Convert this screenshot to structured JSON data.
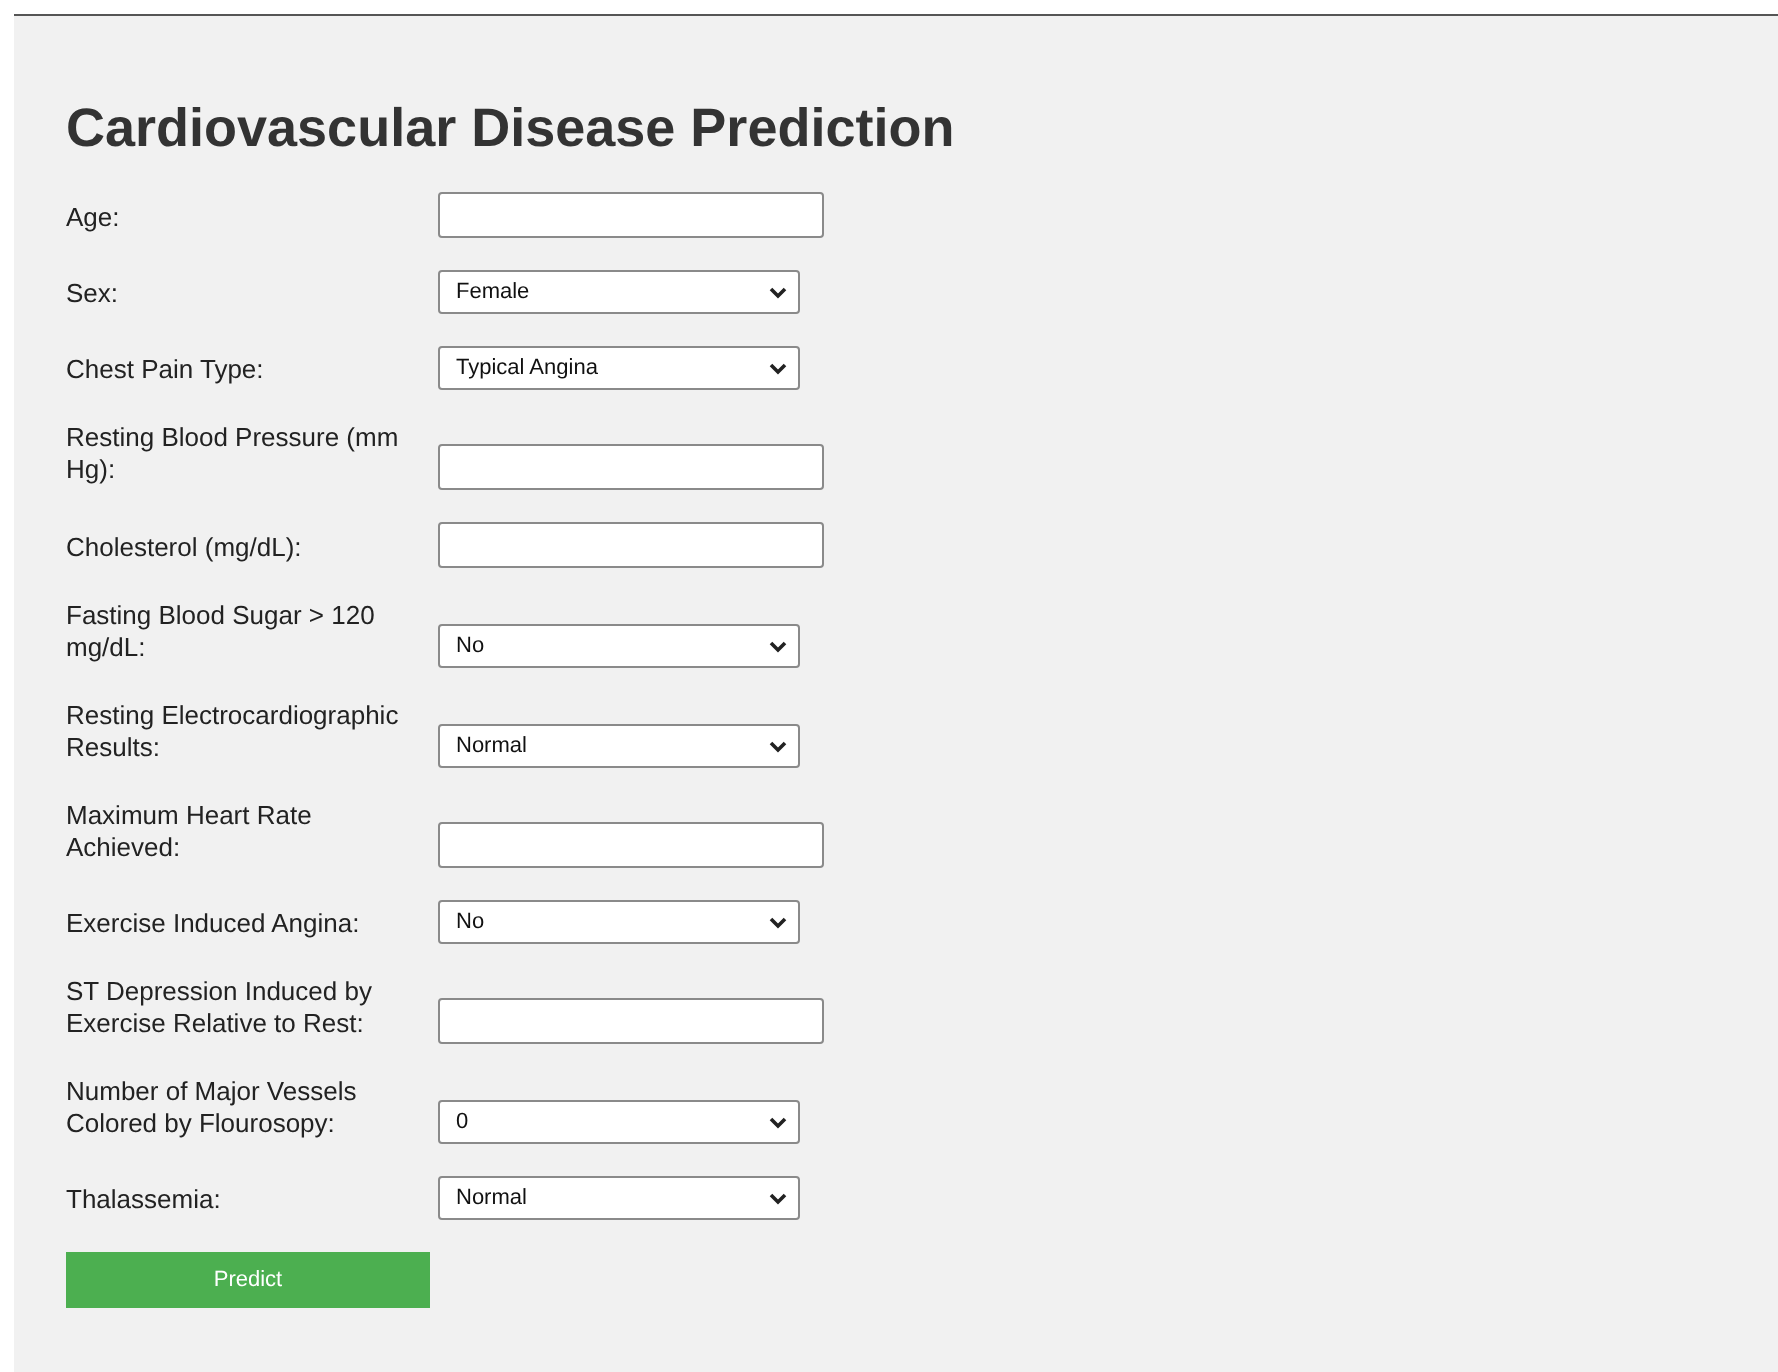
{
  "title": "Cardiovascular Disease Prediction",
  "fields": [
    {
      "label": "Age:",
      "kind": "text"
    },
    {
      "label": "Sex:",
      "kind": "select",
      "value": "Female"
    },
    {
      "label": "Chest Pain Type:",
      "kind": "select",
      "value": "Typical Angina"
    },
    {
      "label": "Resting Blood Pressure (mm Hg):",
      "kind": "text"
    },
    {
      "label": "Cholesterol (mg/dL):",
      "kind": "text"
    },
    {
      "label": "Fasting Blood Sugar > 120 mg/dL:",
      "kind": "select",
      "value": "No"
    },
    {
      "label": "Resting Electrocardiographic Results:",
      "kind": "select",
      "value": "Normal"
    },
    {
      "label": "Maximum Heart Rate Achieved:",
      "kind": "text"
    },
    {
      "label": "Exercise Induced Angina:",
      "kind": "select",
      "value": "No"
    },
    {
      "label": "ST Depression Induced by Exercise Relative to Rest:",
      "kind": "text"
    },
    {
      "label": "Number of Major Vessels Colored by Flourosopy:",
      "kind": "select",
      "value": "0"
    },
    {
      "label": "Thalassemia:",
      "kind": "select",
      "value": "Normal"
    }
  ],
  "submit": "Predict"
}
